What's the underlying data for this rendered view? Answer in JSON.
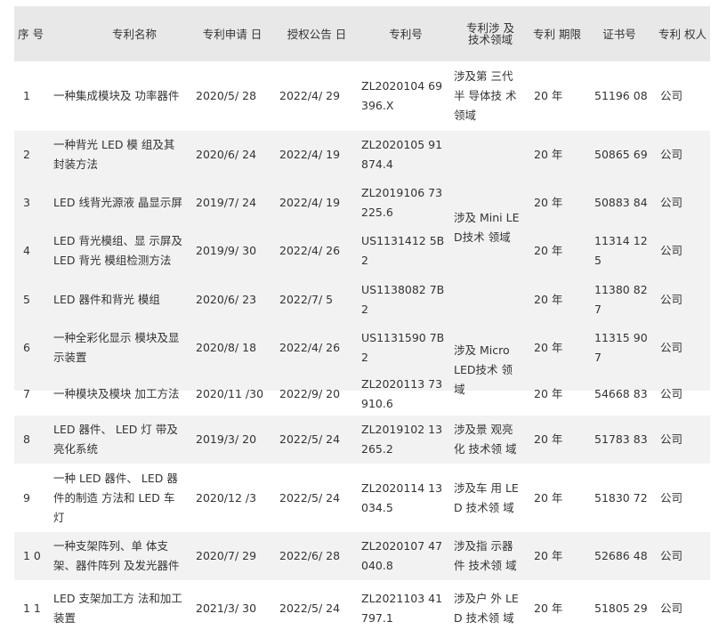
{
  "headers": [
    "序 号",
    "专利名称",
    "专利申请 日",
    "授权公告 日",
    "专利号",
    "专利涉 及技术领域",
    "专利 期限",
    "证书号",
    "专利 权人"
  ],
  "rows": [
    {
      "no": "1",
      "name": "一种集成模块及 功率器件",
      "apply": "2020/5/ 28",
      "grant": "2022/4/ 29",
      "patent": "ZL2020104 69\n396.X",
      "term": "20 年",
      "cert": "51196 08",
      "owner": "公司"
    },
    {
      "no": "2",
      "name": "一种背光 LED 模 组及其\n封装方法",
      "apply": "2020/6/ 24",
      "grant": "2022/4/ 19",
      "patent": "ZL2020105 91\n874.4",
      "term": "20 年",
      "cert": "50865 69",
      "owner": "公司"
    },
    {
      "no": "3",
      "name": "LED 线背光源液 晶显示屏",
      "apply": "2019/7/ 24",
      "grant": "2022/4/ 19",
      "patent": "ZL2019106 73\n225.6",
      "term": "20 年",
      "cert": "50883 84",
      "owner": "公司"
    },
    {
      "no": "4",
      "name": "LED 背光模组、显 示屏及\nLED 背光 模组检测方法",
      "apply": "2019/9/ 30",
      "grant": "2022/4/ 26",
      "patent": "US1131412 5B\n2",
      "term": "20 年",
      "cert": "11314 12\n5",
      "owner": "公司"
    },
    {
      "no": "5",
      "name": "LED 器件和背光 模组",
      "apply": "2020/6/ 23",
      "grant": "2022/7/ 5",
      "patent": "US1138082 7B\n2",
      "term": "20 年",
      "cert": "11380 82\n7",
      "owner": "公司"
    },
    {
      "no": "6",
      "name": "一种全彩化显示 模块及显\n示装置",
      "apply": "2020/8/ 18",
      "grant": "2022/4/ 26",
      "patent": "US1131590 7B\n2",
      "term": "20 年",
      "cert": "11315 90\n7",
      "owner": "公司"
    },
    {
      "no": "7",
      "name": "一种模块及模块 加工方法",
      "apply": "2020/11 /30",
      "grant": "2022/9/ 20",
      "patent": "ZL2020113 73\n910.6",
      "term": "20 年",
      "cert": "54668 83",
      "owner": "公司"
    },
    {
      "no": "8",
      "name": "LED 器件、 LED 灯 带及\n亮化系统",
      "apply": "2019/3/ 20",
      "grant": "2022/5/ 24",
      "patent": "ZL2019102 13\n265.2",
      "term": "20 年",
      "cert": "51783 83",
      "owner": "公司"
    },
    {
      "no": "9",
      "name": "一种 LED 器件、 LED 器\n件的制造 方法和 LED 车\n灯",
      "apply": "2020/12 /3",
      "grant": "2022/5/ 24",
      "patent": "ZL2020114 13\n034.5",
      "term": "20 年",
      "cert": "51830 72",
      "owner": "公司"
    },
    {
      "no": "1 0",
      "name": "一种支架阵列、单 体支\n架、器件阵列 及发光器件",
      "apply": "2020/7/ 29",
      "grant": "2022/6/ 28",
      "patent": "ZL2020107 47\n040.8",
      "term": "20 年",
      "cert": "52686 48",
      "owner": "公司"
    },
    {
      "no": "1 1",
      "name": "LED 支架加工方 法和加工\n装置",
      "apply": "2021/3/ 30",
      "grant": "2022/5/ 24",
      "patent": "ZL2021103 41\n797.1",
      "term": "20 年",
      "cert": "51805 29",
      "owner": "公司"
    }
  ],
  "fields": [
    {
      "text": "涉及第 三代\n半 导体技 术\n领域"
    },
    {
      "text": "涉及 Mini LE\nD技术 领域"
    },
    {
      "text": "涉及 Micro\nLED技术 领\n域"
    },
    {
      "text": "涉及景 观亮\n化 技术领 域"
    },
    {
      "text": "涉及车 用 LE\nD 技术领 域"
    },
    {
      "text": "涉及指 示器\n件 技术领 域"
    },
    {
      "text": "涉及户 外 LE\nD 技术领 域"
    }
  ]
}
